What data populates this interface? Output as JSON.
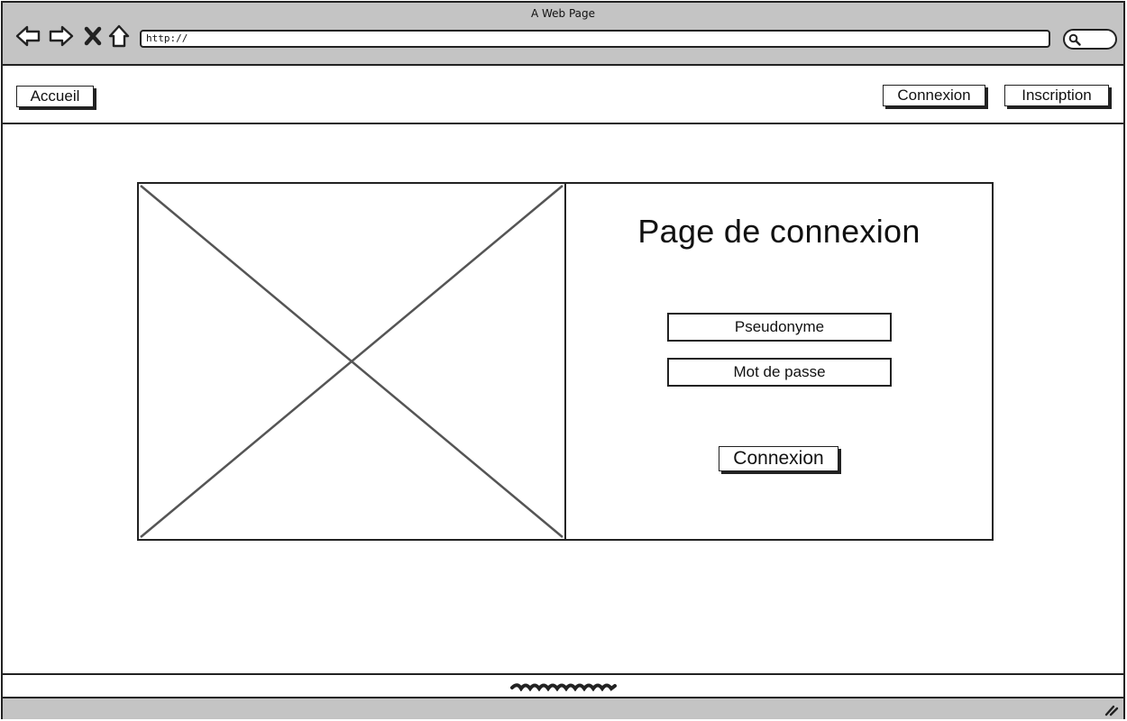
{
  "window": {
    "title": "A Web Page"
  },
  "browser": {
    "url": "http://",
    "icons": [
      "back-arrow-icon",
      "forward-arrow-icon",
      "close-icon",
      "home-icon",
      "search-icon"
    ]
  },
  "nav": {
    "home_label": "Accueil",
    "login_label": "Connexion",
    "signup_label": "Inscription"
  },
  "login": {
    "title": "Page de connexion",
    "username_placeholder": "Pseudonyme",
    "password_placeholder": "Mot de passe",
    "submit_label": "Connexion"
  },
  "colors": {
    "chrome": "#c4c4c4",
    "stroke": "#222222",
    "placeholder_cross": "#555555"
  }
}
